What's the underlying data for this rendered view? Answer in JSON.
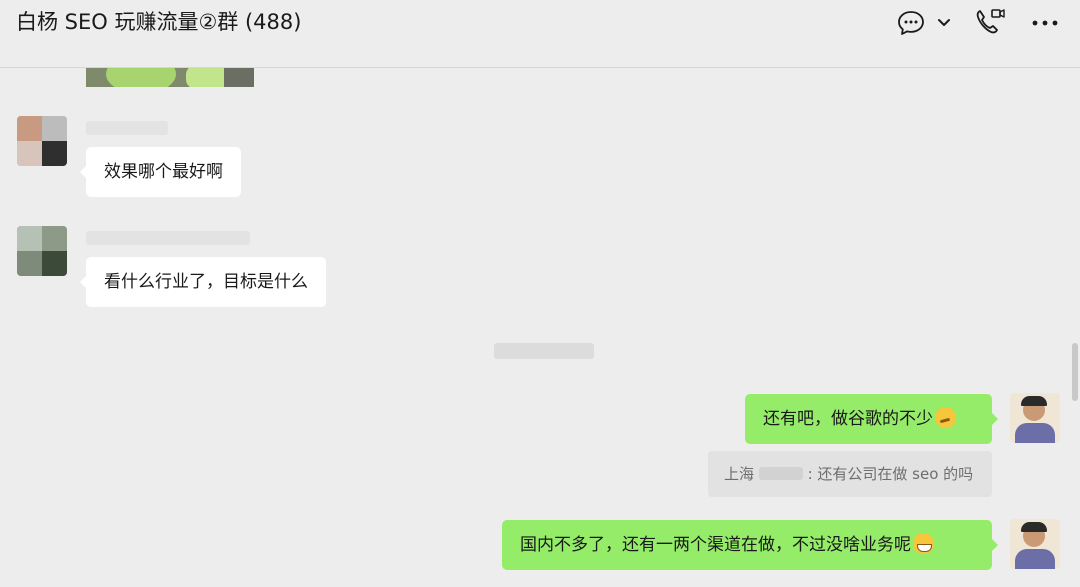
{
  "header": {
    "title": "白杨 SEO 玩赚流量②群 (488)",
    "icons": [
      "chat-bubble-icon",
      "chevron-down-icon",
      "video-call-icon",
      "more-icon"
    ]
  },
  "messages": [
    {
      "side": "left",
      "text": "效果哪个最好啊"
    },
    {
      "side": "left",
      "text": "看什么行业了，目标是什么"
    },
    {
      "side": "right",
      "text": "还有吧，做谷歌的不少",
      "emoji": "thinking-emoji"
    },
    {
      "side": "right",
      "text": "国内不多了，还有一两个渠道在做，不过没啥业务呢",
      "emoji": "grinning-emoji"
    }
  ],
  "quote": {
    "sender": "上海",
    "separator": ": ",
    "text": "还有公司在做 seo 的吗"
  },
  "colors": {
    "background": "#ededed",
    "bubble_self": "#95ec69",
    "bubble_other": "#ffffff",
    "quote_bg": "#e2e2e2"
  }
}
